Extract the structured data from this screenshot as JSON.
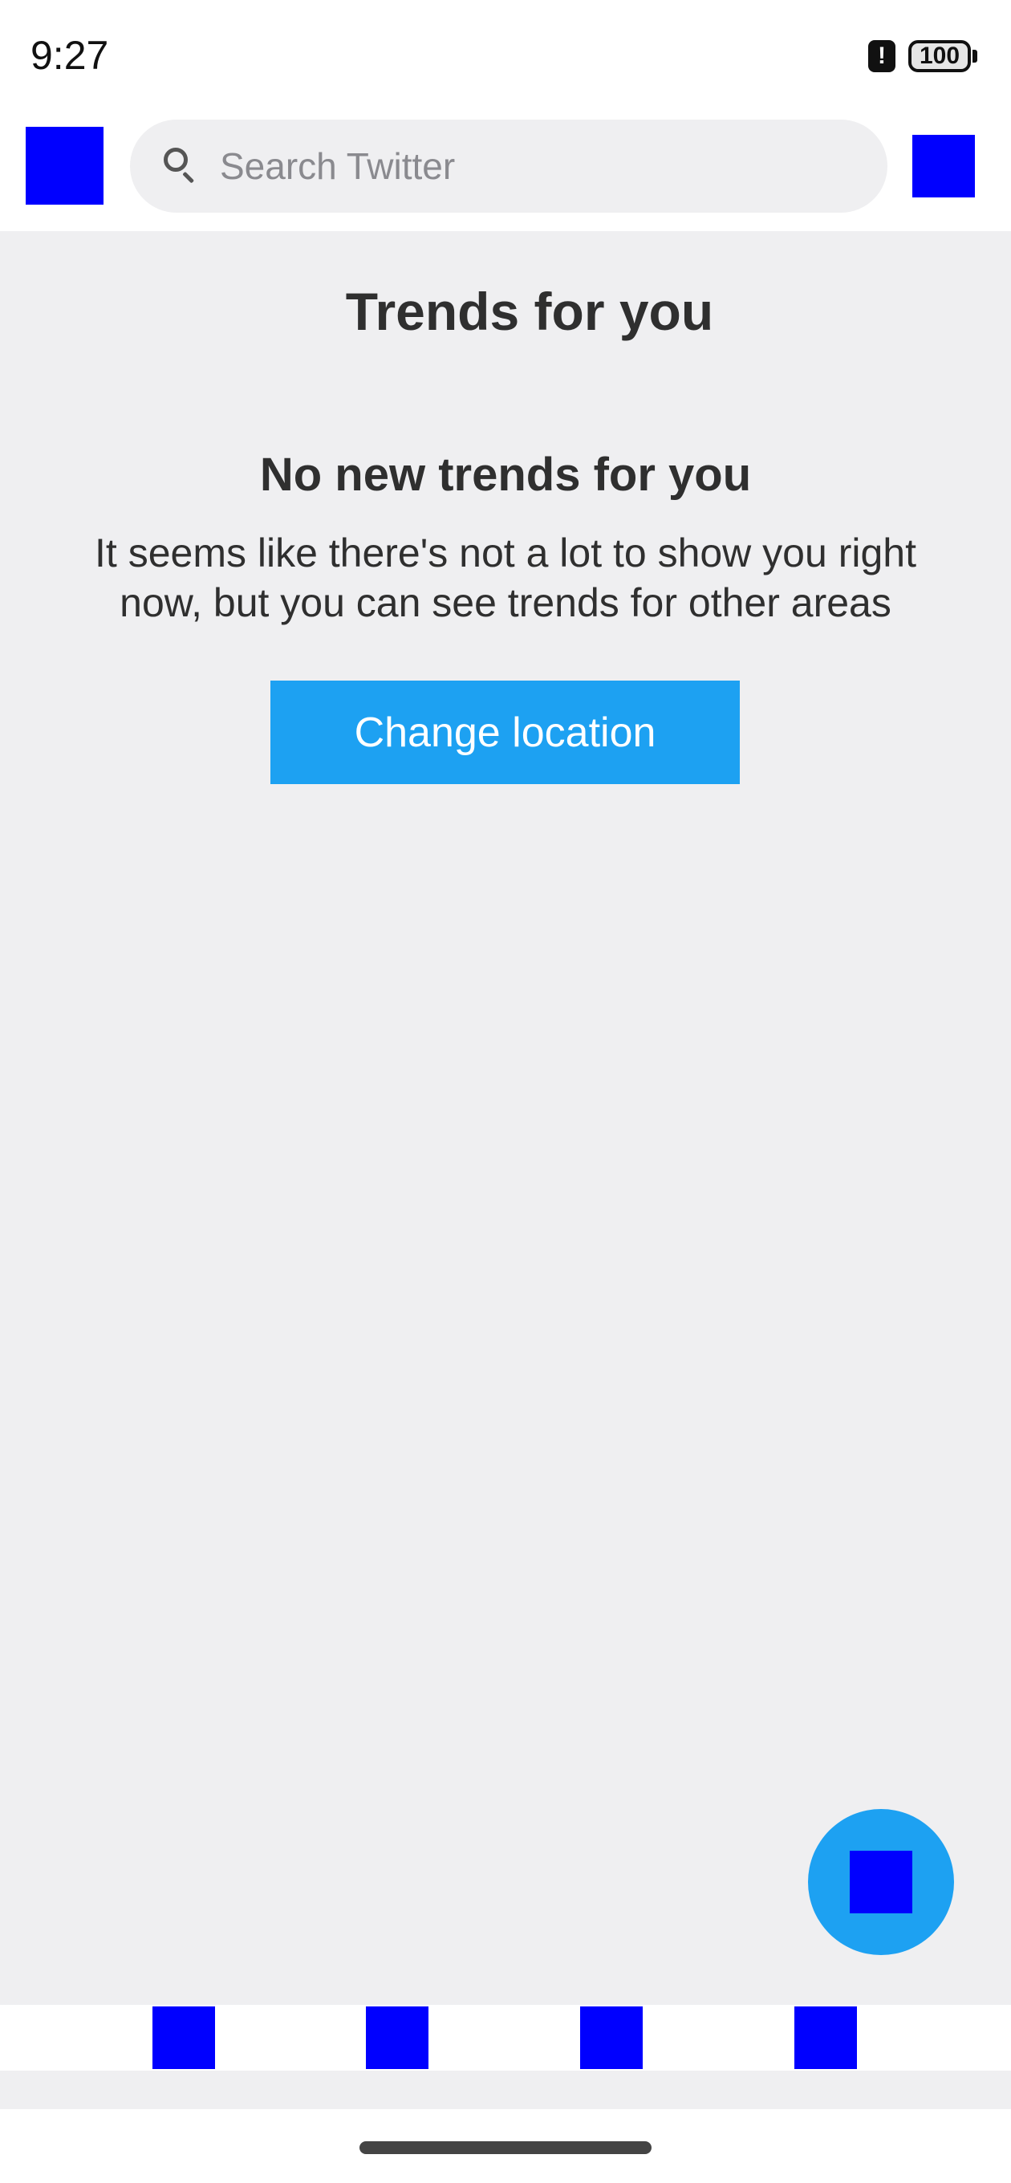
{
  "status_bar": {
    "time": "9:27",
    "alert_glyph": "!",
    "battery": "100"
  },
  "search": {
    "placeholder": "Search Twitter",
    "icon": "search-icon"
  },
  "trends": {
    "title": "Trends for you",
    "empty_title": "No new trends for you",
    "empty_body": "It seems like there's not a lot to show you right now, but you can see trends for other areas",
    "change_location_label": "Change location"
  },
  "icons": {
    "profile": "blue-square-placeholder",
    "settings": "blue-square-placeholder",
    "compose": "blue-square-placeholder",
    "nav": [
      "blue-square-placeholder",
      "blue-square-placeholder",
      "blue-square-placeholder",
      "blue-square-placeholder"
    ]
  },
  "colors": {
    "accent": "#1da1f2",
    "placeholder_icon": "#0000ff",
    "content_background": "#efeff1",
    "text": "#2f2f2f"
  }
}
